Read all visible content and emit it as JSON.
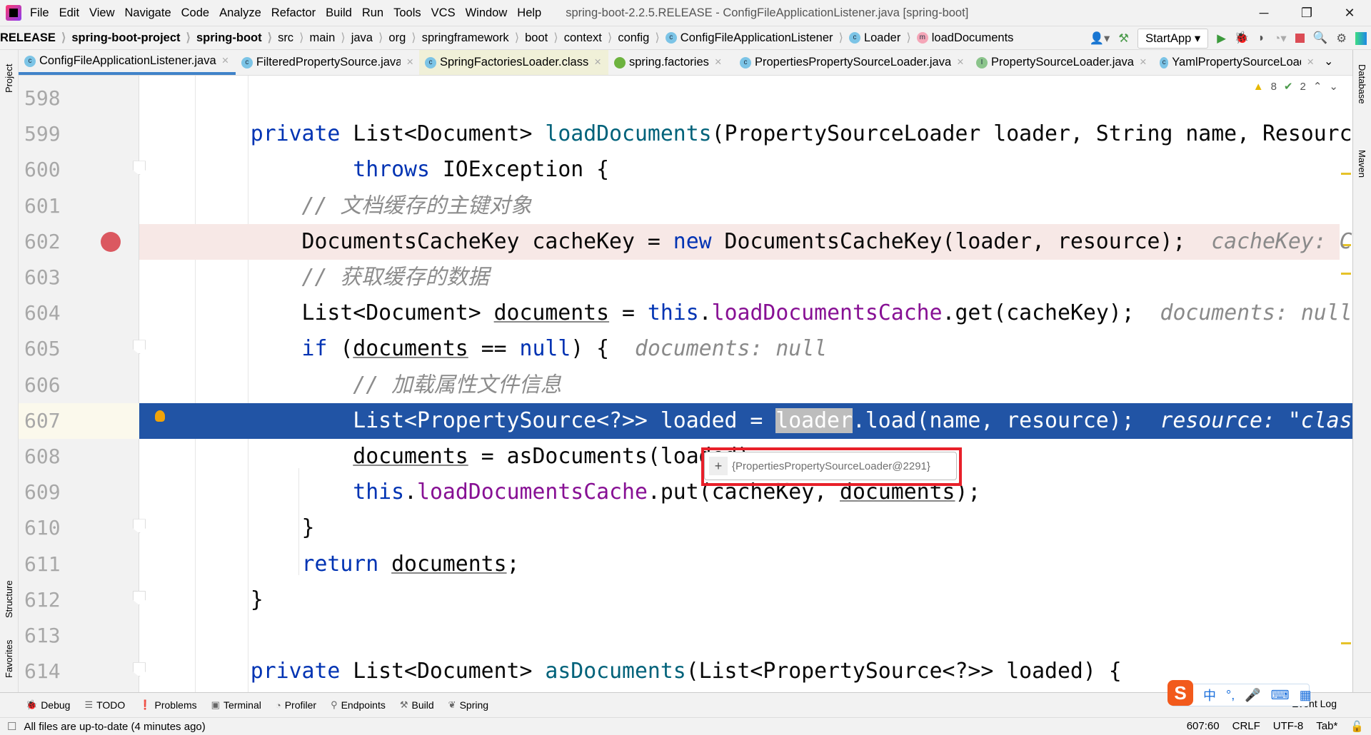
{
  "window": {
    "title": "spring-boot-2.2.5.RELEASE - ConfigFileApplicationListener.java [spring-boot]",
    "minimize": "─",
    "maximize": "❐",
    "close": "✕"
  },
  "menu": [
    "File",
    "Edit",
    "View",
    "Navigate",
    "Code",
    "Analyze",
    "Refactor",
    "Build",
    "Run",
    "Tools",
    "VCS",
    "Window",
    "Help"
  ],
  "breadcrumbs": [
    {
      "label": "RELEASE",
      "bold": true
    },
    {
      "label": "spring-boot-project",
      "bold": true
    },
    {
      "label": "spring-boot",
      "bold": true
    },
    {
      "label": "src"
    },
    {
      "label": "main"
    },
    {
      "label": "java"
    },
    {
      "label": "org"
    },
    {
      "label": "springframework"
    },
    {
      "label": "boot"
    },
    {
      "label": "context"
    },
    {
      "label": "config"
    },
    {
      "label": "ConfigFileApplicationListener",
      "icon": "c"
    },
    {
      "label": "Loader",
      "icon": "c"
    },
    {
      "label": "loadDocuments",
      "icon": "m"
    }
  ],
  "run_config": "StartApp",
  "tabs": [
    {
      "label": "ConfigFileApplicationListener.java",
      "icon": "c",
      "active": true
    },
    {
      "label": "FilteredPropertySource.java",
      "icon": "c"
    },
    {
      "label": "SpringFactoriesLoader.class",
      "icon": "c",
      "cls": true
    },
    {
      "label": "spring.factories",
      "icon": "spring"
    },
    {
      "label": "PropertiesPropertySourceLoader.java",
      "icon": "c"
    },
    {
      "label": "PropertySourceLoader.java",
      "icon": "i"
    },
    {
      "label": "YamlPropertySourceLoader.java",
      "icon": "c"
    }
  ],
  "side": {
    "project": "Project",
    "structure": "Structure",
    "favorites": "Favorites",
    "database": "Database",
    "maven": "Maven"
  },
  "inspections": {
    "warnings": "8",
    "weak_warnings": "2"
  },
  "colors": {
    "accent": "#4083c9",
    "exec_line": "#2154a5",
    "breakpoint_line": "#f7e8e6",
    "breakpoint": "#db5860",
    "keyword": "#0033b3",
    "field": "#871094",
    "method": "#00627a"
  },
  "code": [
    {
      "n": "598",
      "t": []
    },
    {
      "n": "599",
      "t": [
        [
          "",
          "    "
        ],
        [
          "kw",
          "private"
        ],
        [
          "",
          " List<Document> "
        ],
        [
          "md",
          "loadDocuments"
        ],
        [
          "",
          "(PropertySourceLoader loader, String name, Resource resource)"
        ]
      ]
    },
    {
      "n": "600",
      "fold": true,
      "t": [
        [
          "",
          "            "
        ],
        [
          "kw",
          "throws"
        ],
        [
          "",
          " IOException {"
        ]
      ]
    },
    {
      "n": "601",
      "t": [
        [
          "",
          "        "
        ],
        [
          "cm",
          "// 文档缓存的主键对象"
        ]
      ]
    },
    {
      "n": "602",
      "bp": true,
      "t": [
        [
          "",
          "        DocumentsCacheKey cacheKey = "
        ],
        [
          "kw",
          "new"
        ],
        [
          "",
          " DocumentsCacheKey(loader, resource);  "
        ],
        [
          "hint",
          "cacheKey: C"
        ]
      ]
    },
    {
      "n": "603",
      "t": [
        [
          "",
          "        "
        ],
        [
          "cm",
          "// 获取缓存的数据"
        ]
      ]
    },
    {
      "n": "604",
      "t": [
        [
          "",
          "        List<Document> "
        ],
        [
          "ul",
          "documents"
        ],
        [
          "",
          " = "
        ],
        [
          "kw",
          "this"
        ],
        [
          "",
          "."
        ],
        [
          "fd",
          "loadDocumentsCache"
        ],
        [
          "",
          ".get(cacheKey);  "
        ],
        [
          "hint",
          "documents: null"
        ]
      ]
    },
    {
      "n": "605",
      "fold": true,
      "t": [
        [
          "",
          "        "
        ],
        [
          "kw",
          "if"
        ],
        [
          "",
          " ("
        ],
        [
          "ul",
          "documents"
        ],
        [
          "",
          " == "
        ],
        [
          "kw",
          "null"
        ],
        [
          "",
          ") {  "
        ],
        [
          "hint",
          "documents: null"
        ]
      ]
    },
    {
      "n": "606",
      "t": [
        [
          "",
          "            "
        ],
        [
          "cm",
          "// 加载属性文件信息"
        ]
      ]
    },
    {
      "n": "607",
      "exec": true,
      "t": [
        [
          "",
          "            List<PropertySource<?>> loaded = "
        ],
        [
          "sel",
          "loader"
        ],
        [
          "",
          ".load(name, resource);  "
        ],
        [
          "hint",
          "resource: \"class path resource"
        ]
      ]
    },
    {
      "n": "608",
      "t": [
        [
          "",
          "            "
        ],
        [
          "ul",
          "documents"
        ],
        [
          "",
          " = asDocuments(loaded);"
        ]
      ]
    },
    {
      "n": "609",
      "t": [
        [
          "",
          "            "
        ],
        [
          "kw",
          "this"
        ],
        [
          "",
          "."
        ],
        [
          "fd",
          "loadDocumentsCache"
        ],
        [
          "",
          ".put(cacheKey, "
        ],
        [
          "ul",
          "documents"
        ],
        [
          "",
          ");"
        ]
      ]
    },
    {
      "n": "610",
      "fold": true,
      "t": [
        [
          "",
          "        }"
        ]
      ]
    },
    {
      "n": "611",
      "t": [
        [
          "",
          "        "
        ],
        [
          "kw",
          "return"
        ],
        [
          "",
          " "
        ],
        [
          "ul",
          "documents"
        ],
        [
          "",
          ";"
        ]
      ]
    },
    {
      "n": "612",
      "fold": true,
      "t": [
        [
          "",
          "    }"
        ]
      ]
    },
    {
      "n": "613",
      "t": []
    },
    {
      "n": "614",
      "fold": true,
      "t": [
        [
          "",
          "    "
        ],
        [
          "kw",
          "private"
        ],
        [
          "",
          " List<Document> "
        ],
        [
          "md",
          "asDocuments"
        ],
        [
          "",
          "(List<PropertySource<?>> loaded) {"
        ]
      ]
    }
  ],
  "popup": {
    "plus": "+",
    "value": "{PropertiesPropertySourceLoader@2291}"
  },
  "toolwindows": [
    {
      "icon": "🐞",
      "label": "Debug"
    },
    {
      "icon": "☰",
      "label": "TODO"
    },
    {
      "icon": "❗",
      "label": "Problems"
    },
    {
      "icon": "▣",
      "label": "Terminal"
    },
    {
      "icon": "◔",
      "label": "Profiler"
    },
    {
      "icon": "⚲",
      "label": "Endpoints"
    },
    {
      "icon": "⚒",
      "label": "Build"
    },
    {
      "icon": "❦",
      "label": "Spring"
    }
  ],
  "event_log": "Event Log",
  "ime": {
    "logo": "S",
    "items": [
      "中",
      "°,",
      "🎤",
      "⌨",
      "▦"
    ]
  },
  "status": {
    "message": "All files are up-to-date (4 minutes ago)",
    "position": "607:60",
    "line_sep": "CRLF",
    "encoding": "UTF-8",
    "indent": "Tab*"
  }
}
